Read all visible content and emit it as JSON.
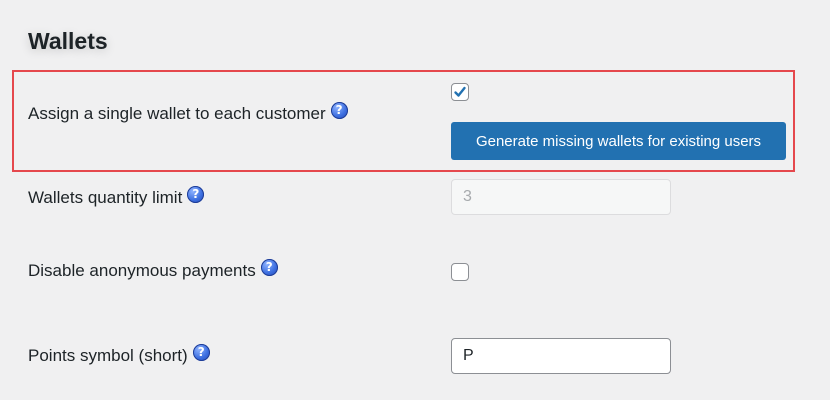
{
  "section": {
    "title": "Wallets"
  },
  "rows": {
    "single_wallet": {
      "label": "Assign a single wallet to each customer",
      "help_icon": "question-help-icon",
      "checked": true,
      "button_label": "Generate missing wallets for existing users"
    },
    "quantity_limit": {
      "label": "Wallets quantity limit",
      "help_icon": "question-help-icon",
      "value": "3",
      "disabled": true
    },
    "anonymous_payments": {
      "label": "Disable anonymous payments",
      "help_icon": "question-help-icon",
      "checked": false
    },
    "points_symbol": {
      "label": "Points symbol (short)",
      "help_icon": "question-help-icon",
      "value": "P"
    }
  },
  "colors": {
    "highlight_border": "#e5484d",
    "primary_button": "#2271b1",
    "checkmark": "#2271b1",
    "background": "#f0f0f1"
  }
}
